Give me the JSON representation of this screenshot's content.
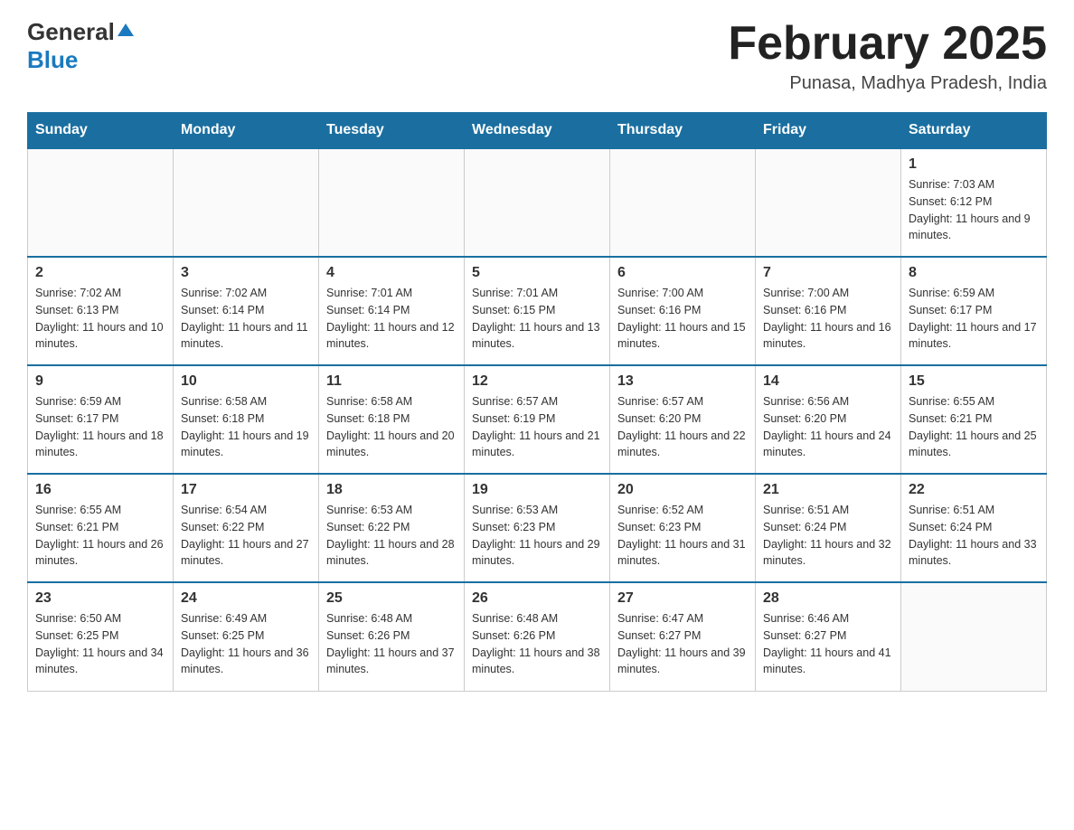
{
  "header": {
    "logo_general": "General",
    "logo_blue": "Blue",
    "calendar_title": "February 2025",
    "location": "Punasa, Madhya Pradesh, India"
  },
  "days_of_week": [
    "Sunday",
    "Monday",
    "Tuesday",
    "Wednesday",
    "Thursday",
    "Friday",
    "Saturday"
  ],
  "weeks": [
    [
      {
        "day": "",
        "info": ""
      },
      {
        "day": "",
        "info": ""
      },
      {
        "day": "",
        "info": ""
      },
      {
        "day": "",
        "info": ""
      },
      {
        "day": "",
        "info": ""
      },
      {
        "day": "",
        "info": ""
      },
      {
        "day": "1",
        "info": "Sunrise: 7:03 AM\nSunset: 6:12 PM\nDaylight: 11 hours and 9 minutes."
      }
    ],
    [
      {
        "day": "2",
        "info": "Sunrise: 7:02 AM\nSunset: 6:13 PM\nDaylight: 11 hours and 10 minutes."
      },
      {
        "day": "3",
        "info": "Sunrise: 7:02 AM\nSunset: 6:14 PM\nDaylight: 11 hours and 11 minutes."
      },
      {
        "day": "4",
        "info": "Sunrise: 7:01 AM\nSunset: 6:14 PM\nDaylight: 11 hours and 12 minutes."
      },
      {
        "day": "5",
        "info": "Sunrise: 7:01 AM\nSunset: 6:15 PM\nDaylight: 11 hours and 13 minutes."
      },
      {
        "day": "6",
        "info": "Sunrise: 7:00 AM\nSunset: 6:16 PM\nDaylight: 11 hours and 15 minutes."
      },
      {
        "day": "7",
        "info": "Sunrise: 7:00 AM\nSunset: 6:16 PM\nDaylight: 11 hours and 16 minutes."
      },
      {
        "day": "8",
        "info": "Sunrise: 6:59 AM\nSunset: 6:17 PM\nDaylight: 11 hours and 17 minutes."
      }
    ],
    [
      {
        "day": "9",
        "info": "Sunrise: 6:59 AM\nSunset: 6:17 PM\nDaylight: 11 hours and 18 minutes."
      },
      {
        "day": "10",
        "info": "Sunrise: 6:58 AM\nSunset: 6:18 PM\nDaylight: 11 hours and 19 minutes."
      },
      {
        "day": "11",
        "info": "Sunrise: 6:58 AM\nSunset: 6:18 PM\nDaylight: 11 hours and 20 minutes."
      },
      {
        "day": "12",
        "info": "Sunrise: 6:57 AM\nSunset: 6:19 PM\nDaylight: 11 hours and 21 minutes."
      },
      {
        "day": "13",
        "info": "Sunrise: 6:57 AM\nSunset: 6:20 PM\nDaylight: 11 hours and 22 minutes."
      },
      {
        "day": "14",
        "info": "Sunrise: 6:56 AM\nSunset: 6:20 PM\nDaylight: 11 hours and 24 minutes."
      },
      {
        "day": "15",
        "info": "Sunrise: 6:55 AM\nSunset: 6:21 PM\nDaylight: 11 hours and 25 minutes."
      }
    ],
    [
      {
        "day": "16",
        "info": "Sunrise: 6:55 AM\nSunset: 6:21 PM\nDaylight: 11 hours and 26 minutes."
      },
      {
        "day": "17",
        "info": "Sunrise: 6:54 AM\nSunset: 6:22 PM\nDaylight: 11 hours and 27 minutes."
      },
      {
        "day": "18",
        "info": "Sunrise: 6:53 AM\nSunset: 6:22 PM\nDaylight: 11 hours and 28 minutes."
      },
      {
        "day": "19",
        "info": "Sunrise: 6:53 AM\nSunset: 6:23 PM\nDaylight: 11 hours and 29 minutes."
      },
      {
        "day": "20",
        "info": "Sunrise: 6:52 AM\nSunset: 6:23 PM\nDaylight: 11 hours and 31 minutes."
      },
      {
        "day": "21",
        "info": "Sunrise: 6:51 AM\nSunset: 6:24 PM\nDaylight: 11 hours and 32 minutes."
      },
      {
        "day": "22",
        "info": "Sunrise: 6:51 AM\nSunset: 6:24 PM\nDaylight: 11 hours and 33 minutes."
      }
    ],
    [
      {
        "day": "23",
        "info": "Sunrise: 6:50 AM\nSunset: 6:25 PM\nDaylight: 11 hours and 34 minutes."
      },
      {
        "day": "24",
        "info": "Sunrise: 6:49 AM\nSunset: 6:25 PM\nDaylight: 11 hours and 36 minutes."
      },
      {
        "day": "25",
        "info": "Sunrise: 6:48 AM\nSunset: 6:26 PM\nDaylight: 11 hours and 37 minutes."
      },
      {
        "day": "26",
        "info": "Sunrise: 6:48 AM\nSunset: 6:26 PM\nDaylight: 11 hours and 38 minutes."
      },
      {
        "day": "27",
        "info": "Sunrise: 6:47 AM\nSunset: 6:27 PM\nDaylight: 11 hours and 39 minutes."
      },
      {
        "day": "28",
        "info": "Sunrise: 6:46 AM\nSunset: 6:27 PM\nDaylight: 11 hours and 41 minutes."
      },
      {
        "day": "",
        "info": ""
      }
    ]
  ]
}
